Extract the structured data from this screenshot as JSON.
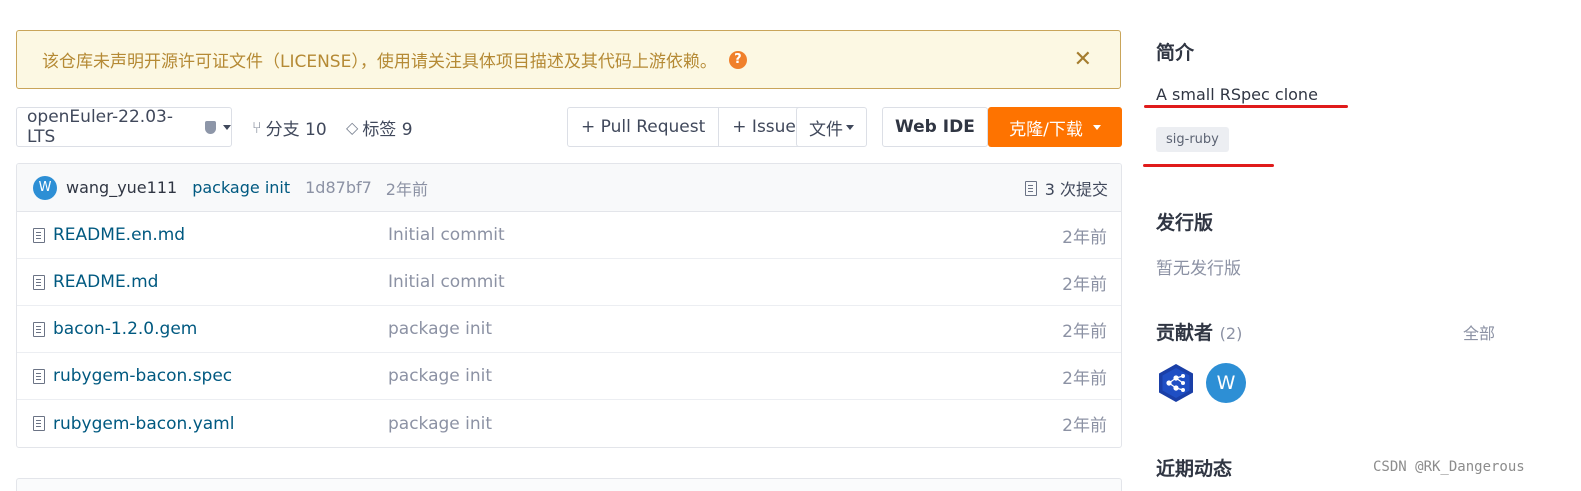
{
  "notice": {
    "text": "该仓库未声明开源许可证文件（LICENSE），使用请关注具体项目描述及其代码上游依赖。",
    "help_glyph": "?",
    "close_glyph": "✕"
  },
  "toolbar": {
    "branch": "openEuler-22.03-LTS",
    "branches_label": "分支 10",
    "tags_label": "标签 9",
    "pull_request": "+ Pull Request",
    "issue": "+ Issue",
    "files": "文件",
    "web_ide": "Web IDE",
    "clone": "克隆/下载"
  },
  "commit": {
    "avatar_letter": "W",
    "author": "wang_yue111",
    "message": "package init",
    "sha": "1d87bf7",
    "time": "2年前",
    "count_label": "3 次提交"
  },
  "files": [
    {
      "name": "README.en.md",
      "commit": "Initial commit",
      "time": "2年前"
    },
    {
      "name": "README.md",
      "commit": "Initial commit",
      "time": "2年前"
    },
    {
      "name": "bacon-1.2.0.gem",
      "commit": "package init",
      "time": "2年前"
    },
    {
      "name": "rubygem-bacon.spec",
      "commit": "package init",
      "time": "2年前"
    },
    {
      "name": "rubygem-bacon.yaml",
      "commit": "package init",
      "time": "2年前"
    }
  ],
  "sidebar": {
    "intro_title": "简介",
    "description": "A small RSpec clone",
    "tag": "sig-ruby",
    "release_title": "发行版",
    "release_empty": "暂无发行版",
    "contributors_title": "贡献者",
    "contributors_count": "(2)",
    "contributors_all": "全部",
    "contributor_letter": "W",
    "activity_title": "近期动态"
  },
  "watermark": "CSDN @RK_Dangerous",
  "colors": {
    "accent": "#fe7300",
    "link": "#005980",
    "annotation_red": "#e01b1b"
  }
}
